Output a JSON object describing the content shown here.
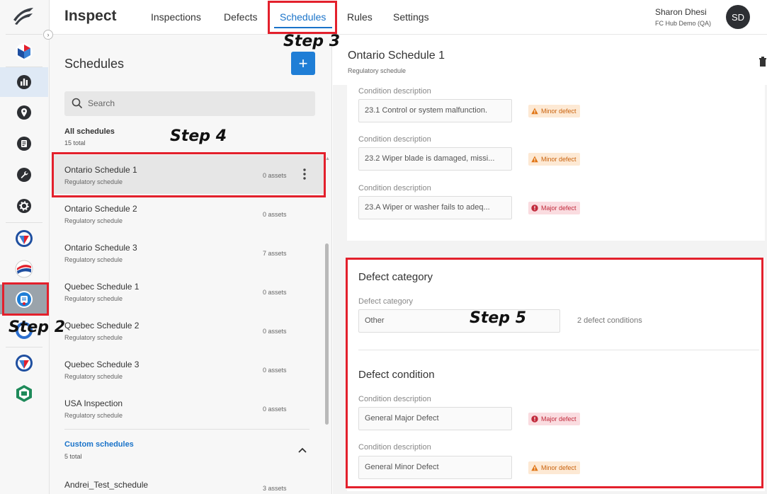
{
  "header": {
    "app_title": "Inspect",
    "nav": [
      {
        "label": "Inspections"
      },
      {
        "label": "Defects"
      },
      {
        "label": "Schedules"
      },
      {
        "label": "Rules"
      },
      {
        "label": "Settings"
      }
    ],
    "active_nav": "Schedules",
    "user_name": "Sharon Dhesi",
    "user_org": "FC Hub Demo (QA)",
    "avatar_initials": "SD"
  },
  "list_panel": {
    "title": "Schedules",
    "add_button": "+",
    "search_placeholder": "Search",
    "all_group": {
      "title": "All schedules",
      "count": "15 total"
    },
    "items": [
      {
        "name": "Ontario Schedule 1",
        "type": "Regulatory schedule",
        "assets": "0 assets"
      },
      {
        "name": "Ontario Schedule 2",
        "type": "Regulatory schedule",
        "assets": "0 assets"
      },
      {
        "name": "Ontario Schedule 3",
        "type": "Regulatory schedule",
        "assets": "7 assets"
      },
      {
        "name": "Quebec Schedule 1",
        "type": "Regulatory schedule",
        "assets": "0 assets"
      },
      {
        "name": "Quebec Schedule 2",
        "type": "Regulatory schedule",
        "assets": "0 assets"
      },
      {
        "name": "Quebec Schedule 3",
        "type": "Regulatory schedule",
        "assets": "0 assets"
      },
      {
        "name": "USA Inspection",
        "type": "Regulatory schedule",
        "assets": "0 assets"
      }
    ],
    "custom_group": {
      "title": "Custom schedules",
      "count": "5 total"
    },
    "custom_items": [
      {
        "name": "Andrei_Test_schedule",
        "assets": "3 assets"
      }
    ]
  },
  "detail": {
    "title": "Ontario Schedule 1",
    "subtitle": "Regulatory schedule",
    "conditions_top": [
      {
        "label": "Condition description",
        "value": "23.1 Control or system malfunction.",
        "badge": "Minor defect",
        "severity": "minor"
      },
      {
        "label": "Condition description",
        "value": "23.2 Wiper blade is damaged, missi...",
        "badge": "Minor defect",
        "severity": "minor"
      },
      {
        "label": "Condition description",
        "value": "23.A Wiper or washer fails to adeq...",
        "badge": "Major defect",
        "severity": "major"
      }
    ],
    "category": {
      "section_title": "Defect category",
      "label": "Defect category",
      "value": "Other",
      "count": "2 defect conditions"
    },
    "defect_condition": {
      "section_title": "Defect condition",
      "items": [
        {
          "label": "Condition description",
          "value": "General Major Defect",
          "badge": "Major defect",
          "severity": "major"
        },
        {
          "label": "Condition description",
          "value": "General Minor Defect",
          "badge": "Minor defect",
          "severity": "minor"
        }
      ]
    }
  },
  "annotations": {
    "step2": "Step 2",
    "step3": "Step 3",
    "step4": "Step 4",
    "step5": "Step 5"
  },
  "colors": {
    "accent": "#1a73c9",
    "add_button": "#1f7ed6",
    "highlight": "#e3202c",
    "minor_bg": "#fde9d4",
    "minor_text": "#c9620d",
    "major_bg": "#fadce0",
    "major_text": "#c12a3c"
  },
  "icons": {
    "rail": [
      "logo-icon",
      "cube-icon",
      "chart-icon",
      "location-icon",
      "document-icon",
      "wrench-icon",
      "gear-icon",
      "app-icon",
      "app-icon",
      "inspect-icon",
      "app-icon",
      "app-icon",
      "app-icon"
    ]
  }
}
